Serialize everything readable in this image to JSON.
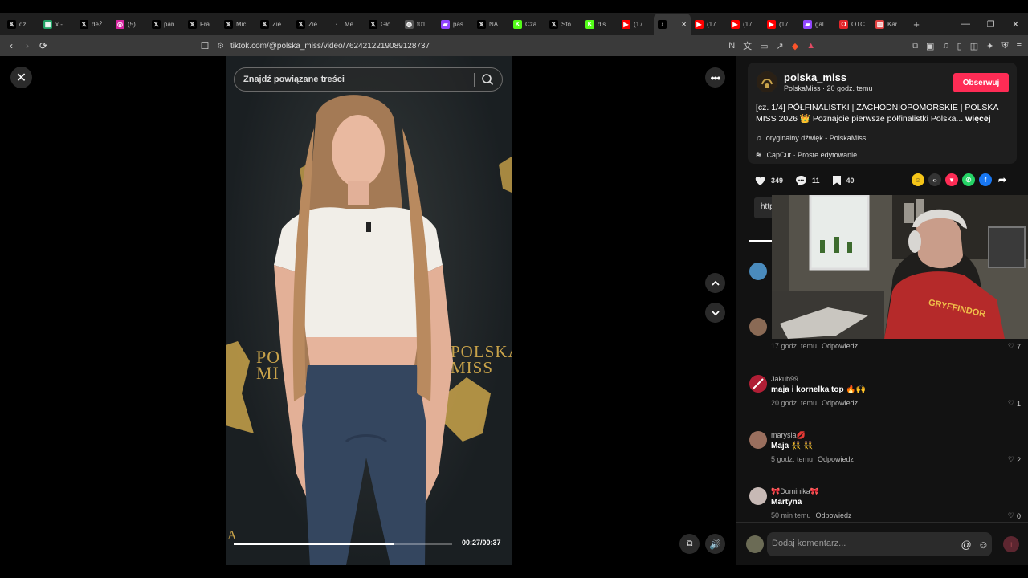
{
  "browser": {
    "tabs": [
      {
        "label": "dzi",
        "icon": "x-icon",
        "color": "#000000"
      },
      {
        "label": "x -",
        "icon": "sheet-icon",
        "color": "#21a366"
      },
      {
        "label": "deŽ",
        "icon": "x-icon",
        "color": "#000000"
      },
      {
        "label": "(5)",
        "icon": "instagram-icon",
        "color": "#d6249f"
      },
      {
        "label": "pan",
        "icon": "x-icon",
        "color": "#000000"
      },
      {
        "label": "Fra",
        "icon": "x-icon",
        "color": "#000000"
      },
      {
        "label": "Mic",
        "icon": "x-icon",
        "color": "#000000"
      },
      {
        "label": "Zie",
        "icon": "x-icon",
        "color": "#000000"
      },
      {
        "label": "Zie",
        "icon": "x-icon",
        "color": "#000000"
      },
      {
        "label": "Me",
        "icon": "generic-icon",
        "color": "#1f1f1f"
      },
      {
        "label": "Głc",
        "icon": "x-icon",
        "color": "#000000"
      },
      {
        "label": "f01",
        "icon": "globe-icon",
        "color": "#555555"
      },
      {
        "label": "pas",
        "icon": "twitch-icon",
        "color": "#9146ff"
      },
      {
        "label": "NA",
        "icon": "x-icon",
        "color": "#000000"
      },
      {
        "label": "Cza",
        "icon": "kick-icon",
        "color": "#53fc18"
      },
      {
        "label": "Sto",
        "icon": "x-icon",
        "color": "#000000"
      },
      {
        "label": "dis",
        "icon": "kick-icon",
        "color": "#53fc18"
      },
      {
        "label": "(17",
        "icon": "youtube-icon",
        "color": "#ff0000"
      },
      {
        "label": "",
        "icon": "tiktok-icon",
        "color": "#000000",
        "active": true
      },
      {
        "label": "(17",
        "icon": "youtube-icon",
        "color": "#ff0000"
      },
      {
        "label": "(17",
        "icon": "youtube-icon",
        "color": "#ff0000"
      },
      {
        "label": "(17",
        "icon": "youtube-icon",
        "color": "#ff0000"
      },
      {
        "label": "gal",
        "icon": "twitch-icon",
        "color": "#9146ff"
      },
      {
        "label": "OTC",
        "icon": "opera-icon",
        "color": "#e4252a"
      },
      {
        "label": "Kar",
        "icon": "chart-icon",
        "color": "#e04040"
      }
    ],
    "new_tab": "+",
    "url": "tiktok.com/@polska_miss/video/7624212219089128737"
  },
  "video": {
    "search_placeholder": "Znajdź powiązane treści",
    "banner_left": "PO\nMI",
    "banner_right": "POLSKA\nMISS",
    "banner_bottom": "A",
    "progress": 0.73,
    "timecode": "00:27/00:37"
  },
  "author": {
    "username": "polska_miss",
    "meta": "PolskaMiss · 20 godz. temu",
    "follow_label": "Obserwuj",
    "description": "[cz. 1/4] PÓŁFINALISTKI | ZACHODNIOPOMORSKIE | POLSKA MISS 2026 👑 Poznajcie pierwsze półfinalistki Polska...",
    "more_label": "więcej",
    "music": "oryginalny dźwięk - PolskaMiss",
    "capcut": "CapCut · Proste edytowanie"
  },
  "stats": {
    "likes": "349",
    "comments": "11",
    "saves": "40"
  },
  "link_chip": "http",
  "comments": [
    {
      "name": "",
      "text": "",
      "time": "17 godz. temu",
      "reply": "Odpowiedz",
      "likes": "7"
    },
    {
      "name": "Jakub99",
      "text": "maja i kornelka top 🔥🙌",
      "time": "20 godz. temu",
      "reply": "Odpowiedz",
      "likes": "1"
    },
    {
      "name": "marysia💋",
      "text": "Maja 👯 👯",
      "time": "5 godz. temu",
      "reply": "Odpowiedz",
      "likes": "2"
    },
    {
      "name": "🎀Dominika🎀",
      "text": "Martyna",
      "time": "50 min temu",
      "reply": "Odpowiedz",
      "likes": "0"
    }
  ],
  "composer": {
    "placeholder": "Dodaj komentarz..."
  },
  "colors": {
    "accent": "#fe2c55",
    "gold": "#c9a34a"
  }
}
